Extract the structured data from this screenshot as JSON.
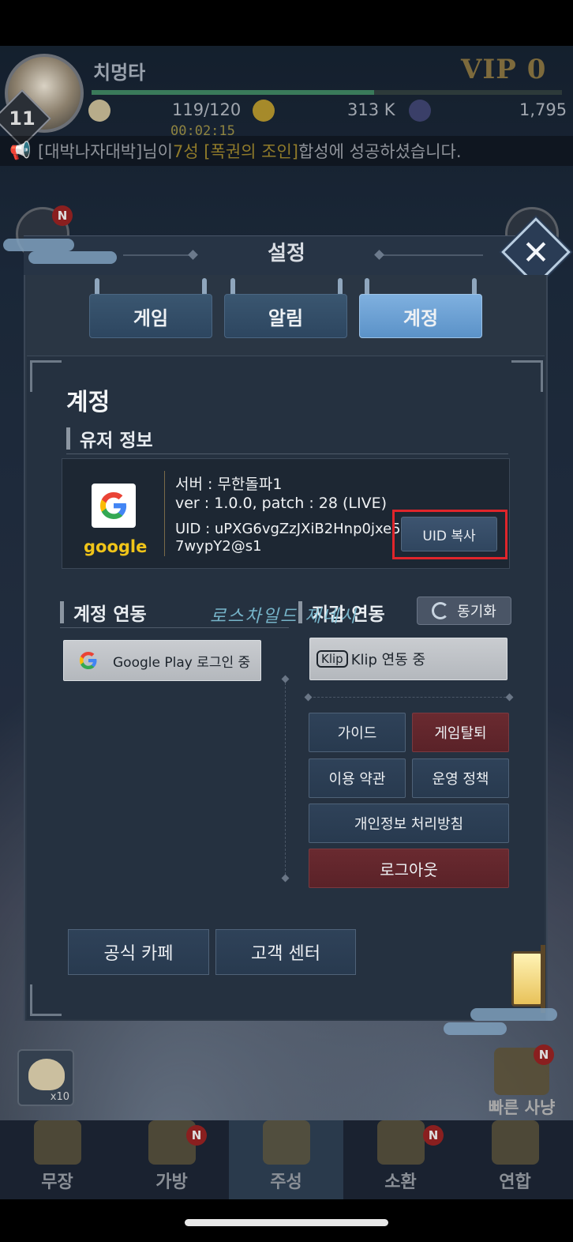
{
  "hud": {
    "player_name": "치멍타",
    "level": "11",
    "vip": "VIP 0",
    "stamina": "119/120",
    "gold": "313 K",
    "gems": "1,795",
    "timer": "00:02:15"
  },
  "notice": {
    "prefix": "[대박나자대박]님이 ",
    "highlight": "7성 [폭권의 조인]",
    "suffix": " 합성에 성공하셨습니다."
  },
  "settings": {
    "title": "설정",
    "tabs": [
      {
        "label": "게임",
        "active": false
      },
      {
        "label": "알림",
        "active": false
      },
      {
        "label": "계정",
        "active": true
      }
    ],
    "section_title": "계정",
    "user_info": {
      "heading": "유저 정보",
      "provider_label": "google",
      "server": "서버 : 무한돌파1",
      "version": "ver : 1.0.0, patch : 28 (LIVE)",
      "uid_line1": "UID : uPXG6vgZzJXiB2Hnp0jxe5",
      "uid_line2": "7wypY2@s1",
      "copy_uid_button": "UID 복사"
    },
    "account_link": {
      "heading": "계정 연동",
      "google_button": "Google Play 로그인 중"
    },
    "wallet_link": {
      "heading": "지갑 연동",
      "sync_button": "동기화",
      "klip_badge": "Klip",
      "klip_button": "Klip 연동 중"
    },
    "menu": {
      "guide": "가이드",
      "withdraw": "게임탈퇴",
      "terms": "이용 약관",
      "policy": "운영 정책",
      "privacy": "개인정보 처리방침",
      "logout": "로그아웃"
    },
    "footer": {
      "cafe": "공식 카페",
      "support": "고객 센터"
    },
    "watermark": "로스차일드 제네시"
  },
  "bottom_nav": [
    {
      "label": "무장",
      "badge": ""
    },
    {
      "label": "가방",
      "badge": "N"
    },
    {
      "label": "주성",
      "badge": ""
    },
    {
      "label": "소환",
      "badge": "N"
    },
    {
      "label": "연합",
      "badge": ""
    }
  ],
  "quick_hunt": {
    "label": "빠른 사냥",
    "badge": "N"
  },
  "bun_slot": {
    "count": "x10"
  },
  "colors": {
    "accent_tab": "#6ea2d6",
    "highlight_box": "#e0252b",
    "google_gold": "#f0c419",
    "danger_button": "#5a2228"
  }
}
